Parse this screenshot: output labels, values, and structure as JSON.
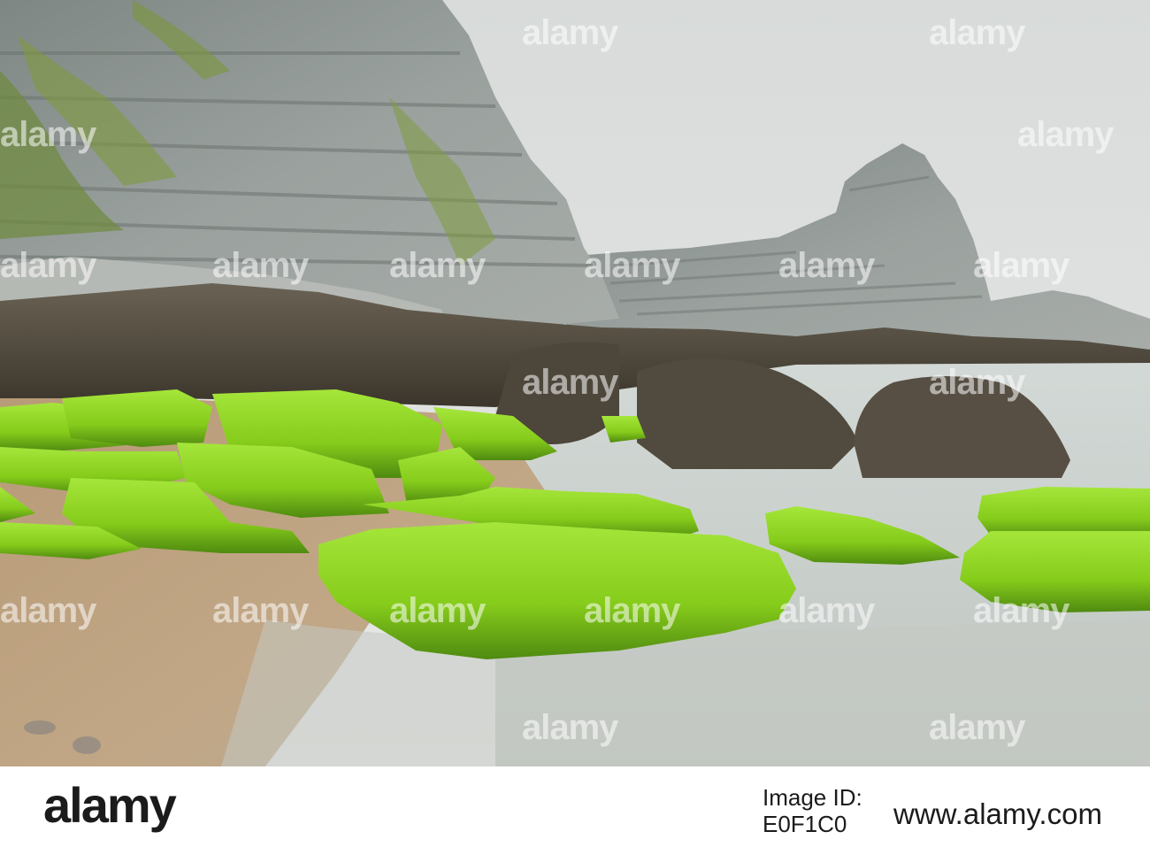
{
  "watermark": {
    "text": "alamy",
    "text_color": "#ffffff"
  },
  "footer": {
    "logo": "alamy",
    "image_id_label": "Image ID:",
    "image_id": "E0F1C0",
    "site": "www.alamy.com"
  },
  "colors": {
    "sky": "#dfe2e1",
    "cliff": "#8e9594",
    "moss": "#8cd41e",
    "sand": "#b89a7a",
    "water": "#c8cfcb",
    "rock": "#4a4438"
  }
}
